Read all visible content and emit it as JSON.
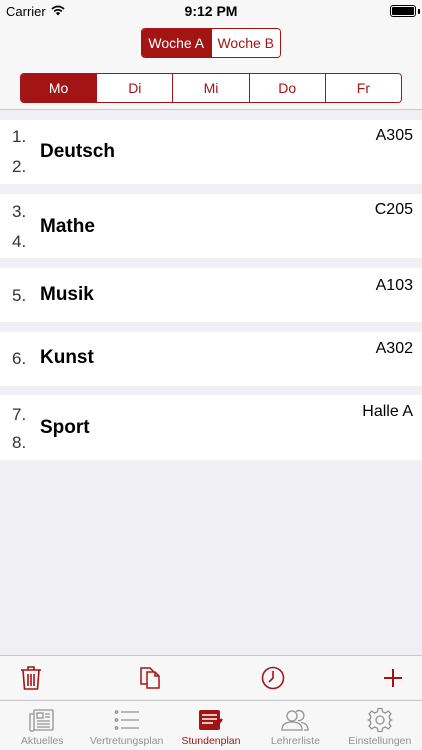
{
  "status_bar": {
    "carrier": "Carrier",
    "time": "9:12 PM"
  },
  "week_selector": {
    "options": [
      "Woche A",
      "Woche B"
    ],
    "selected": 0
  },
  "day_selector": {
    "options": [
      "Mo",
      "Di",
      "Mi",
      "Do",
      "Fr"
    ],
    "selected": 0
  },
  "lessons": [
    {
      "periods": [
        "1.",
        "2."
      ],
      "subject": "Deutsch",
      "room": "A305"
    },
    {
      "periods": [
        "3.",
        "4."
      ],
      "subject": "Mathe",
      "room": "C205"
    },
    {
      "periods": [
        "5."
      ],
      "subject": "Musik",
      "room": "A103"
    },
    {
      "periods": [
        "6."
      ],
      "subject": "Kunst",
      "room": "A302"
    },
    {
      "periods": [
        "7.",
        "8."
      ],
      "subject": "Sport",
      "room": "Halle A"
    }
  ],
  "toolbar": {
    "icons": [
      "trash-icon",
      "copy-icon",
      "clock-icon",
      "plus-icon"
    ]
  },
  "tabbar": {
    "items": [
      {
        "label": "Aktuelles",
        "icon": "newspaper-icon"
      },
      {
        "label": "Vertretungsplan",
        "icon": "list-icon"
      },
      {
        "label": "Stundenplan",
        "icon": "timetable-icon"
      },
      {
        "label": "Lehrerliste",
        "icon": "people-icon"
      },
      {
        "label": "Einstellungen",
        "icon": "gear-icon"
      }
    ],
    "selected": 2
  },
  "colors": {
    "accent": "#a31515",
    "inactive_tab": "#929292",
    "background": "#efeff4"
  }
}
